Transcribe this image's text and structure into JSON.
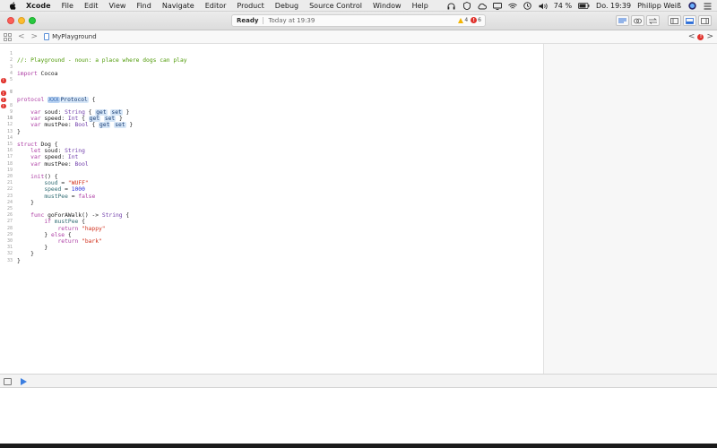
{
  "menubar": {
    "items": [
      "Xcode",
      "File",
      "Edit",
      "View",
      "Find",
      "Navigate",
      "Editor",
      "Product",
      "Debug",
      "Source Control",
      "Window",
      "Help"
    ],
    "battery": "74 %",
    "clock": "Do. 19:39",
    "user": "Philipp Weiß"
  },
  "toolbar": {
    "status": "Ready",
    "time": "Today at 19:39",
    "warnings": "4",
    "errors": "6"
  },
  "jumpbar": {
    "file": "MyPlayground",
    "back": "<",
    "forward": ">"
  },
  "code": {
    "lines": [
      {
        "n": "1",
        "err": false
      },
      {
        "n": "2",
        "err": false
      },
      {
        "n": "3",
        "err": false
      },
      {
        "n": "4",
        "err": false
      },
      {
        "n": "5",
        "err": false
      },
      {
        "n": "6",
        "err": true
      },
      {
        "n": "7",
        "err": false
      },
      {
        "n": "8",
        "err": true
      },
      {
        "n": "9",
        "err": true
      },
      {
        "n": "10",
        "err": true
      },
      {
        "n": "11",
        "err": false
      },
      {
        "n": "12",
        "err": false
      },
      {
        "n": "13",
        "err": false
      },
      {
        "n": "14",
        "err": false
      },
      {
        "n": "15",
        "err": false
      },
      {
        "n": "16",
        "err": false
      },
      {
        "n": "17",
        "err": false
      },
      {
        "n": "18",
        "err": false
      },
      {
        "n": "19",
        "err": false
      },
      {
        "n": "20",
        "err": false
      },
      {
        "n": "21",
        "err": false
      },
      {
        "n": "22",
        "err": false
      },
      {
        "n": "23",
        "err": false
      },
      {
        "n": "24",
        "err": false
      },
      {
        "n": "25",
        "err": false
      },
      {
        "n": "26",
        "err": false
      },
      {
        "n": "27",
        "err": false
      },
      {
        "n": "28",
        "err": false
      },
      {
        "n": "29",
        "err": false
      },
      {
        "n": "30",
        "err": false
      },
      {
        "n": "31",
        "err": false
      },
      {
        "n": "32",
        "err": false
      },
      {
        "n": "33",
        "err": false
      }
    ],
    "tokens": {
      "l1": "//: Playground - noun: a place where dogs can play",
      "import": "import",
      "cocoa": "Cocoa",
      "protocol": "protocol",
      "ph_xxx": "XXX",
      "ph_protocol": "Protocol",
      "brace_open": "{",
      "brace_close": "}",
      "var": "var",
      "let": "let",
      "soud": "soud",
      "speed": "speed",
      "mustPee": "mustPee",
      "colon": ":",
      "String": "String",
      "Int": "Int",
      "Bool": "Bool",
      "get": "get",
      "set": "set",
      "struct": "struct",
      "Dog": "Dog",
      "init": "init",
      "parens": "()",
      "eq": "=",
      "wuff": "\"WUFF\"",
      "n1000": "1000",
      "false": "false",
      "func": "func",
      "goForAWalk": "goForAWalk",
      "arrow": "->",
      "if": "if",
      "else": "else",
      "return": "return",
      "happy": "\"happy\"",
      "bark": "\"bark\""
    }
  },
  "icons": {
    "apple": "apple-icon",
    "play": "play-icon"
  }
}
